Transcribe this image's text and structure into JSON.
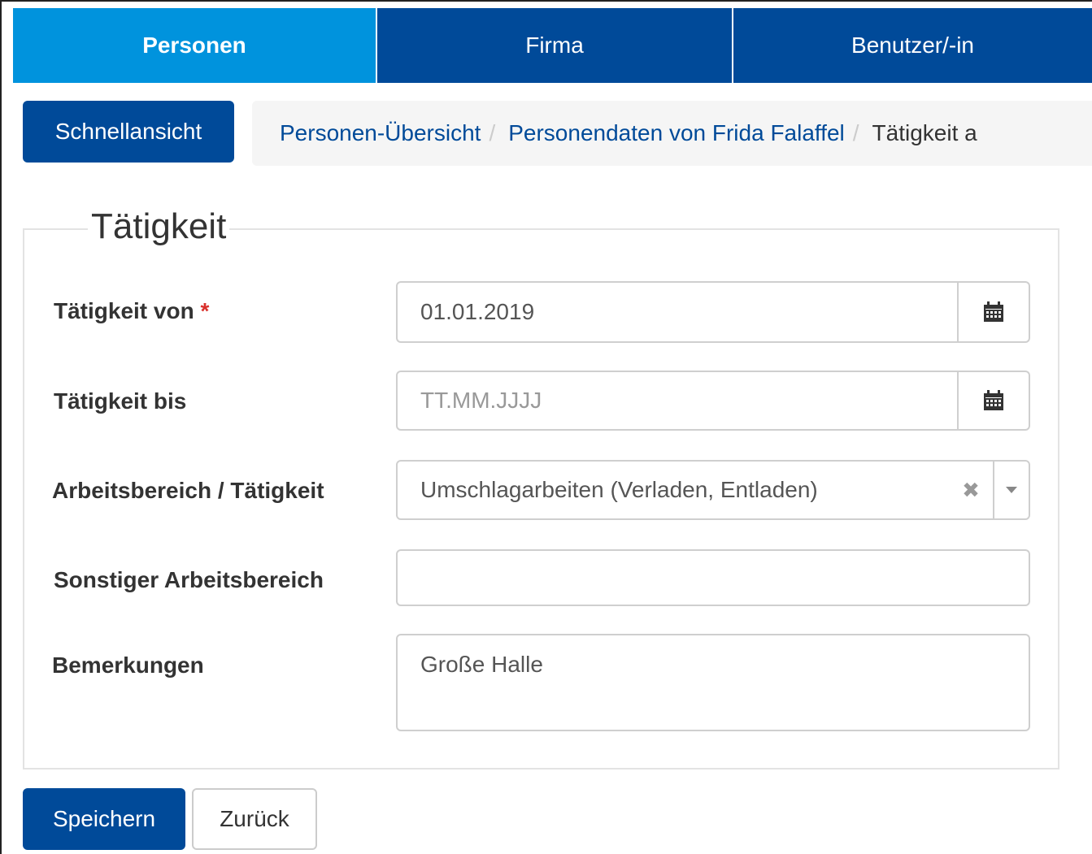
{
  "nav": {
    "tabs": [
      {
        "label": "Personen",
        "active": true
      },
      {
        "label": "Firma",
        "active": false
      },
      {
        "label": "Benutzer/-in",
        "active": false
      }
    ]
  },
  "quick_view_label": "Schnellansicht",
  "breadcrumb": {
    "items": [
      "Personen-Übersicht",
      "Personendaten von Frida Falaffel"
    ],
    "separator": "/",
    "current": "Tätigkeit a"
  },
  "form": {
    "legend": "Tätigkeit",
    "required_marker": "*",
    "fields": {
      "from": {
        "label": "Tätigkeit von",
        "value": "01.01.2019",
        "icon": "calendar-icon",
        "required": true
      },
      "to": {
        "label": "Tätigkeit bis",
        "value": "",
        "placeholder": "TT.MM.JJJJ",
        "icon": "calendar-icon"
      },
      "area": {
        "label": "Arbeitsbereich / Tätigkeit",
        "value": "Umschlagarbeiten (Verladen, Entladen)",
        "clear_glyph": "✖"
      },
      "other_area": {
        "label": "Sonstiger Arbeitsbereich",
        "value": ""
      },
      "notes": {
        "label": "Bemerkungen",
        "value": "Große Halle"
      }
    }
  },
  "actions": {
    "save": "Speichern",
    "back": "Zurück"
  },
  "colors": {
    "primary": "#004a99",
    "active_tab": "#0093dd",
    "required": "#d9302b"
  }
}
